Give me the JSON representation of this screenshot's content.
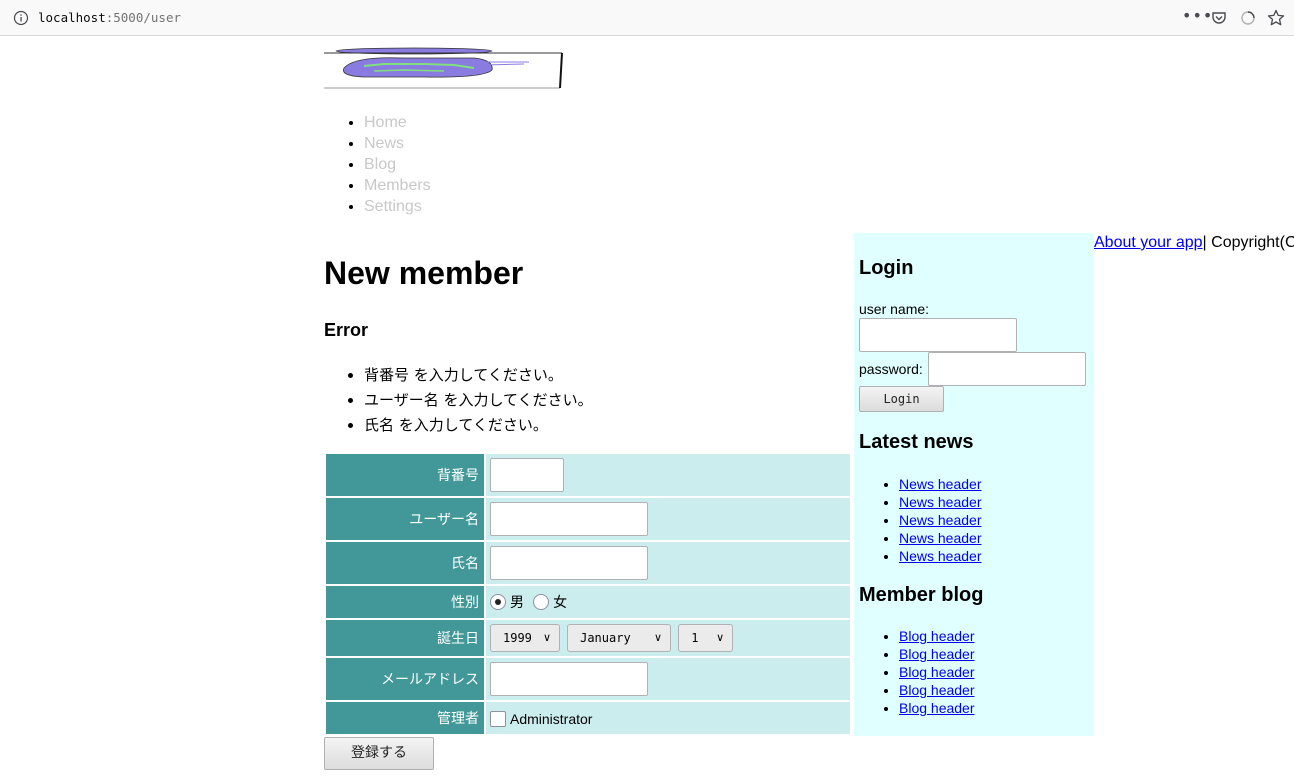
{
  "browser": {
    "url_host": "localhost",
    "url_path": ":5000/user"
  },
  "nav": {
    "items": [
      "Home",
      "News",
      "Blog",
      "Members",
      "Settings"
    ]
  },
  "main": {
    "title": "New member",
    "error_title": "Error",
    "errors": [
      "背番号 を入力してください。",
      "ユーザー名 を入力してください。",
      "氏名 を入力してください。"
    ],
    "form": {
      "number_label": "背番号",
      "number_value": "",
      "username_label": "ユーザー名",
      "username_value": "",
      "fullname_label": "氏名",
      "fullname_value": "",
      "gender_label": "性別",
      "gender_male": "男",
      "gender_female": "女",
      "gender_selected": "男",
      "birthday_label": "誕生日",
      "birth_year": "1999",
      "birth_month": "January",
      "birth_day": "1",
      "email_label": "メールアドレス",
      "email_value": "",
      "admin_label": "管理者",
      "admin_checkbox_label": "Administrator",
      "admin_checked": false
    },
    "submit_label": "登録する"
  },
  "sidebar": {
    "login_title": "Login",
    "username_label": "user name:",
    "password_label": "password:",
    "login_button": "Login",
    "news_title": "Latest news",
    "news_items": [
      "News header",
      "News header",
      "News header",
      "News header",
      "News header"
    ],
    "blog_title": "Member blog",
    "blog_items": [
      "Blog header",
      "Blog header",
      "Blog header",
      "Blog header",
      "Blog header"
    ]
  },
  "footer": {
    "about_link": "About your app",
    "copyright": "| Copyright(C"
  },
  "colors": {
    "label_bg": "#429898",
    "field_bg": "#cceded",
    "sidebar_bg": "#e0ffff",
    "nav_link": "#c8c8c8",
    "link": "#0000ee"
  }
}
